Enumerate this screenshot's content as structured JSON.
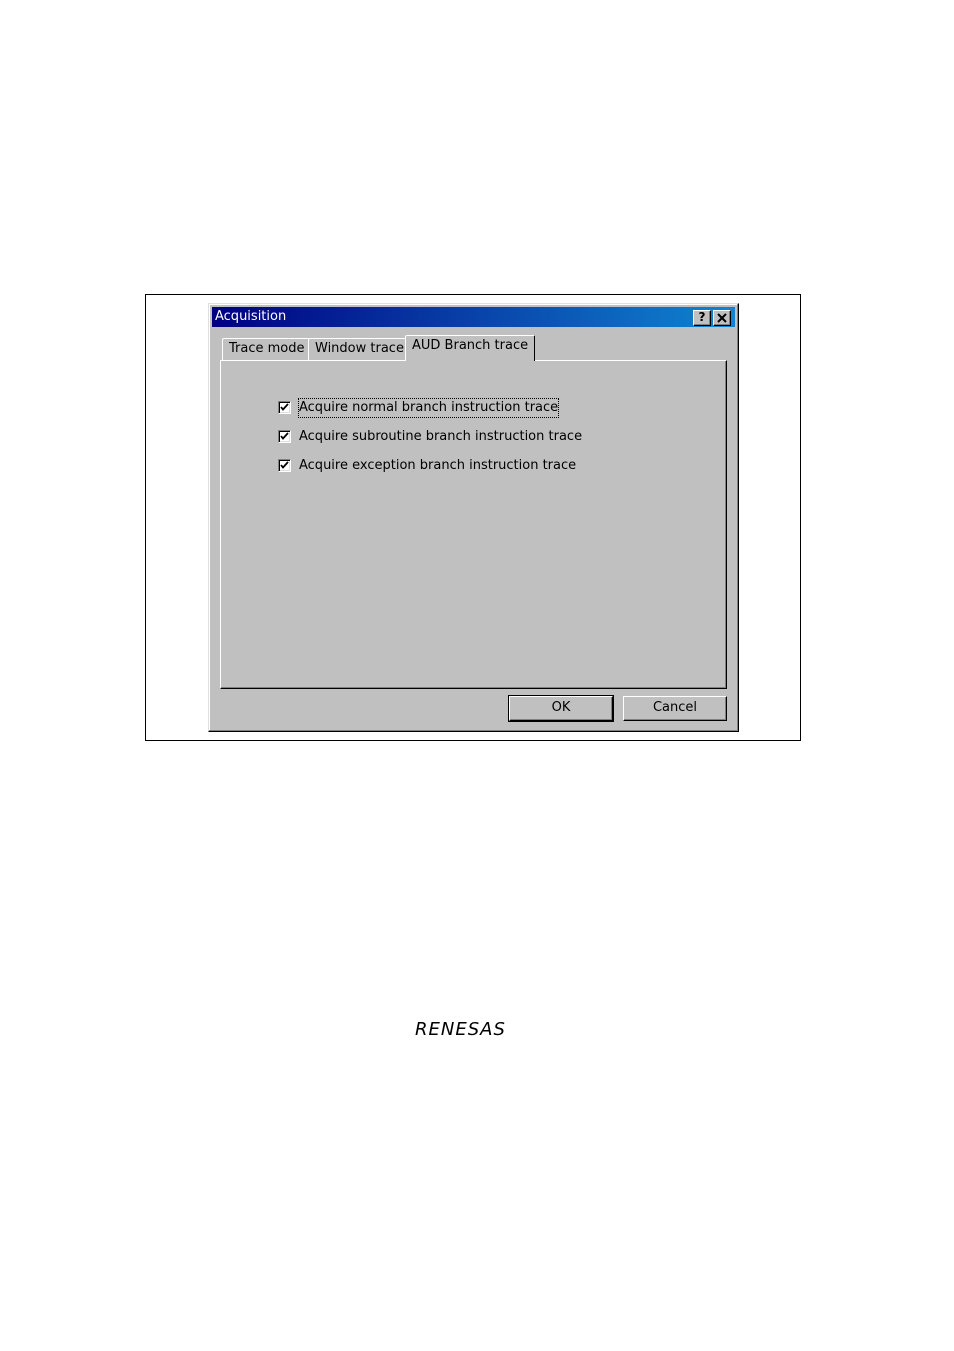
{
  "dialog": {
    "title": "Acquisition",
    "help_button": "?",
    "close_button": "✕",
    "tabs": [
      {
        "label": "Trace mode"
      },
      {
        "label": "Window trace"
      },
      {
        "label": "AUD Branch trace"
      }
    ],
    "options": [
      {
        "label": "Acquire normal branch instruction trace",
        "checked": true
      },
      {
        "label": "Acquire subroutine branch instruction trace",
        "checked": true
      },
      {
        "label": "Acquire exception branch instruction trace",
        "checked": true
      }
    ],
    "ok_label": "OK",
    "cancel_label": "Cancel"
  },
  "footer": {
    "logo": "RENESAS"
  }
}
